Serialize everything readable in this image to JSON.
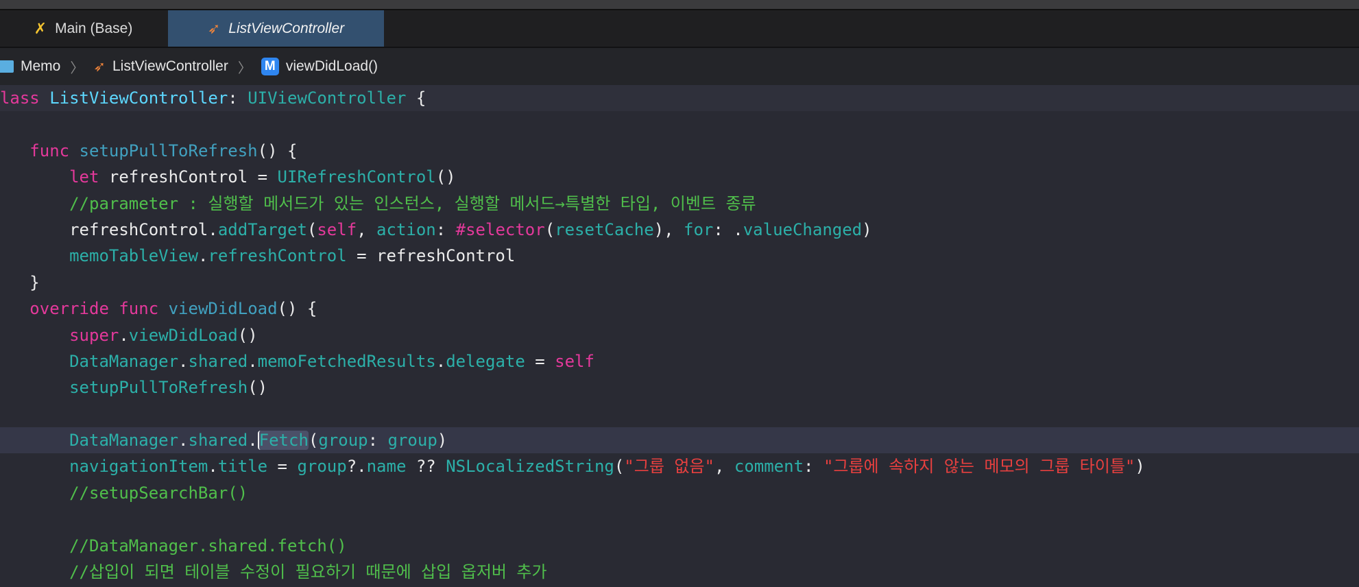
{
  "tabs": [
    {
      "label": "Main (Base)",
      "icon": "interface-builder-icon",
      "active": false
    },
    {
      "label": "ListViewController",
      "icon": "swift-icon",
      "active": true
    }
  ],
  "breadcrumb": [
    {
      "label": "Memo",
      "icon": "folder-icon"
    },
    {
      "label": "ListViewController",
      "icon": "swift-icon"
    },
    {
      "label": "viewDidLoad()",
      "icon": "method-icon",
      "badge": "M"
    }
  ],
  "colors": {
    "keyword": "#e4399b",
    "type": "#2cb0a9",
    "comment": "#50bf4b",
    "string": "#e8403f",
    "active_tab": "#33506f"
  },
  "code": [
    [
      [
        "class",
        "kw"
      ],
      [
        " ",
        "pl"
      ],
      [
        "ListViewController",
        "cls"
      ],
      [
        ": ",
        "pl"
      ],
      [
        "UIViewController",
        "type"
      ],
      [
        " {",
        "pl"
      ]
    ],
    [],
    [
      [
        "    ",
        "pl"
      ],
      [
        "func",
        "kw"
      ],
      [
        " ",
        "pl"
      ],
      [
        "setupPullToRefresh",
        "fn"
      ],
      [
        "() {",
        "pl"
      ]
    ],
    [
      [
        "        ",
        "pl"
      ],
      [
        "let",
        "kw"
      ],
      [
        " refreshControl = ",
        "pl"
      ],
      [
        "UIRefreshControl",
        "type"
      ],
      [
        "()",
        "pl"
      ]
    ],
    [
      [
        "        ",
        "pl"
      ],
      [
        "//parameter : 실행할 메서드가 있는 인스턴스, 실행할 메서드→특별한 타입, 이벤트 종류",
        "cm"
      ]
    ],
    [
      [
        "        refreshControl.",
        "pl"
      ],
      [
        "addTarget",
        "type"
      ],
      [
        "(",
        "pl"
      ],
      [
        "self",
        "kw"
      ],
      [
        ", ",
        "pl"
      ],
      [
        "action",
        "type"
      ],
      [
        ": ",
        "pl"
      ],
      [
        "#selector",
        "kw"
      ],
      [
        "(",
        "pl"
      ],
      [
        "resetCache",
        "type"
      ],
      [
        "), ",
        "pl"
      ],
      [
        "for",
        "type"
      ],
      [
        ": .",
        "pl"
      ],
      [
        "valueChanged",
        "type"
      ],
      [
        ")",
        "pl"
      ]
    ],
    [
      [
        "        ",
        "pl"
      ],
      [
        "memoTableView",
        "type"
      ],
      [
        ".",
        "pl"
      ],
      [
        "refreshControl",
        "type"
      ],
      [
        " = refreshControl",
        "pl"
      ]
    ],
    [
      [
        "    }",
        "pl"
      ]
    ],
    [
      [
        "    ",
        "pl"
      ],
      [
        "override",
        "kw"
      ],
      [
        " ",
        "pl"
      ],
      [
        "func",
        "kw"
      ],
      [
        " ",
        "pl"
      ],
      [
        "viewDidLoad",
        "fn"
      ],
      [
        "() {",
        "pl"
      ]
    ],
    [
      [
        "        ",
        "pl"
      ],
      [
        "super",
        "kw"
      ],
      [
        ".",
        "pl"
      ],
      [
        "viewDidLoad",
        "type"
      ],
      [
        "()",
        "pl"
      ]
    ],
    [
      [
        "        ",
        "pl"
      ],
      [
        "DataManager",
        "type"
      ],
      [
        ".",
        "pl"
      ],
      [
        "shared",
        "type"
      ],
      [
        ".",
        "pl"
      ],
      [
        "memoFetchedResults",
        "type"
      ],
      [
        ".",
        "pl"
      ],
      [
        "delegate",
        "type"
      ],
      [
        " = ",
        "pl"
      ],
      [
        "self",
        "kw"
      ]
    ],
    [
      [
        "        ",
        "pl"
      ],
      [
        "setupPullToRefresh",
        "type"
      ],
      [
        "()",
        "pl"
      ]
    ],
    [],
    [
      [
        "        ",
        "pl"
      ],
      [
        "DataManager",
        "type"
      ],
      [
        ".",
        "pl"
      ],
      [
        "shared",
        "type"
      ],
      [
        ".",
        "pl"
      ],
      [
        "Fetch",
        "type sel caret"
      ],
      [
        "(",
        "pl"
      ],
      [
        "group",
        "type"
      ],
      [
        ": ",
        "pl"
      ],
      [
        "group",
        "type"
      ],
      [
        ")",
        "pl"
      ]
    ],
    [
      [
        "        ",
        "pl"
      ],
      [
        "navigationItem",
        "type"
      ],
      [
        ".",
        "pl"
      ],
      [
        "title",
        "type"
      ],
      [
        " = ",
        "pl"
      ],
      [
        "group",
        "type"
      ],
      [
        "?.",
        "pl"
      ],
      [
        "name",
        "type"
      ],
      [
        " ?? ",
        "pl"
      ],
      [
        "NSLocalizedString",
        "type"
      ],
      [
        "(",
        "pl"
      ],
      [
        "\"그룹 없음\"",
        "str"
      ],
      [
        ", ",
        "pl"
      ],
      [
        "comment",
        "type"
      ],
      [
        ": ",
        "pl"
      ],
      [
        "\"그룹에 속하지 않는 메모의 그룹 타이틀\"",
        "str"
      ],
      [
        ")",
        "pl"
      ]
    ],
    [
      [
        "        ",
        "pl"
      ],
      [
        "//setupSearchBar()",
        "cm"
      ]
    ],
    [],
    [
      [
        "        ",
        "pl"
      ],
      [
        "//DataManager.shared.fetch()",
        "cm"
      ]
    ],
    [
      [
        "        ",
        "pl"
      ],
      [
        "//삽입이 되면 테이블 수정이 필요하기 때문에 삽입 옵저버 추가",
        "cm"
      ]
    ]
  ]
}
